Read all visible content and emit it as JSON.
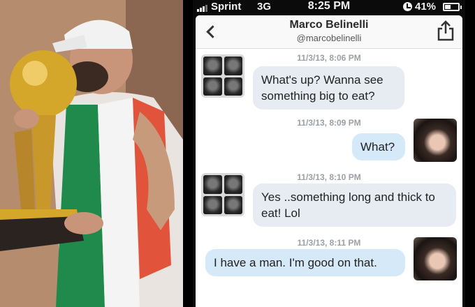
{
  "status_bar": {
    "carrier": "Sprint",
    "network": "3G",
    "time": "8:25 PM",
    "battery_percent": "41%",
    "battery_level": 0.41,
    "icons": [
      "signal-bars-icon",
      "alarm-clock-icon",
      "battery-icon"
    ]
  },
  "header": {
    "name": "Marco Belinelli",
    "handle": "@marcobelinelli",
    "back_icon": "chevron-left-icon",
    "share_icon": "share-icon"
  },
  "messages": [
    {
      "timestamp": "11/3/13, 8:06 PM",
      "text": "What's up? Wanna see something big to eat?",
      "direction": "incoming"
    },
    {
      "timestamp": "11/3/13, 8:09 PM",
      "text": "What?",
      "direction": "outgoing"
    },
    {
      "timestamp": "11/3/13, 8:10 PM",
      "text": "Yes ..something long and thick to eat! Lol",
      "direction": "incoming"
    },
    {
      "timestamp": "11/3/13, 8:11 PM",
      "text": "I have a man. I'm good on that.",
      "direction": "outgoing"
    }
  ],
  "colors": {
    "incoming_bubble": "#e6ecf2",
    "outgoing_bubble": "#d6e9f8",
    "timestamp": "#9aa0a6"
  }
}
